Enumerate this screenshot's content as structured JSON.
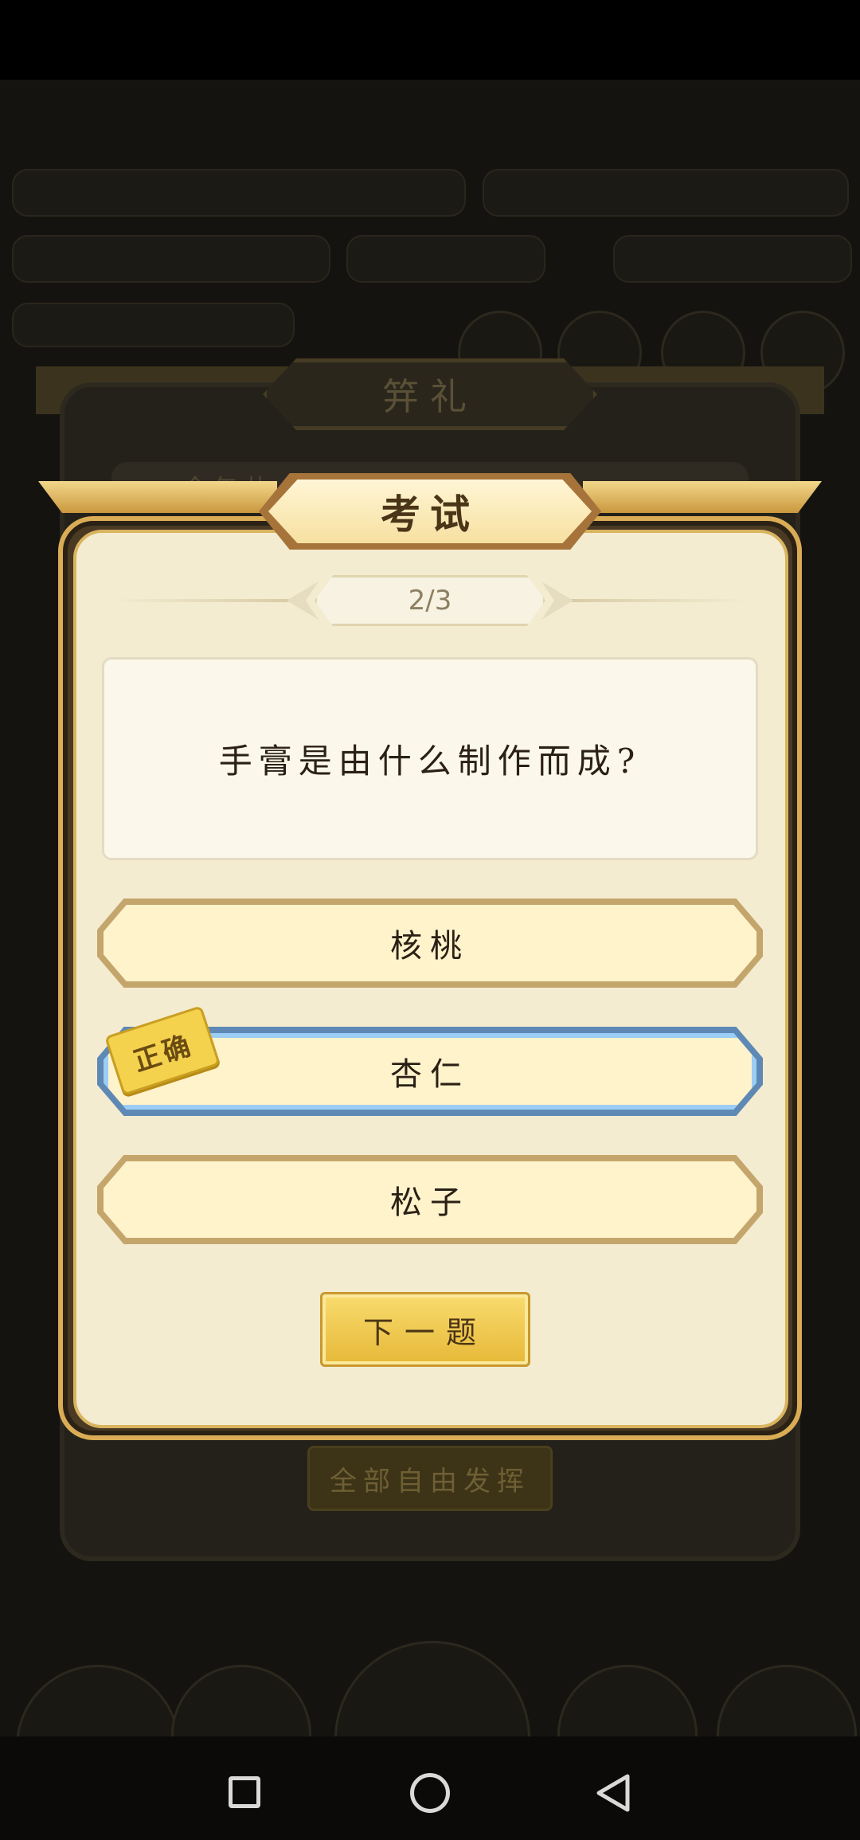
{
  "background": {
    "dialog_title": "笄礼",
    "subtext": "今年共 ... 礼仪式",
    "footer_button": "全部自由发挥"
  },
  "exam": {
    "title": "考试",
    "progress": "2/3",
    "question": "手膏是由什么制作而成?",
    "options": [
      {
        "label": "核桃",
        "state": "normal"
      },
      {
        "label": "杏仁",
        "state": "correct"
      },
      {
        "label": "松子",
        "state": "normal"
      }
    ],
    "correct_badge": "正确",
    "next_button": "下一题"
  },
  "colors": {
    "frame_gold": "#d9ac55",
    "panel_cream": "#f4ecd1",
    "correct_blue": "#9ccdf4",
    "button_gold": "#e7b838"
  }
}
